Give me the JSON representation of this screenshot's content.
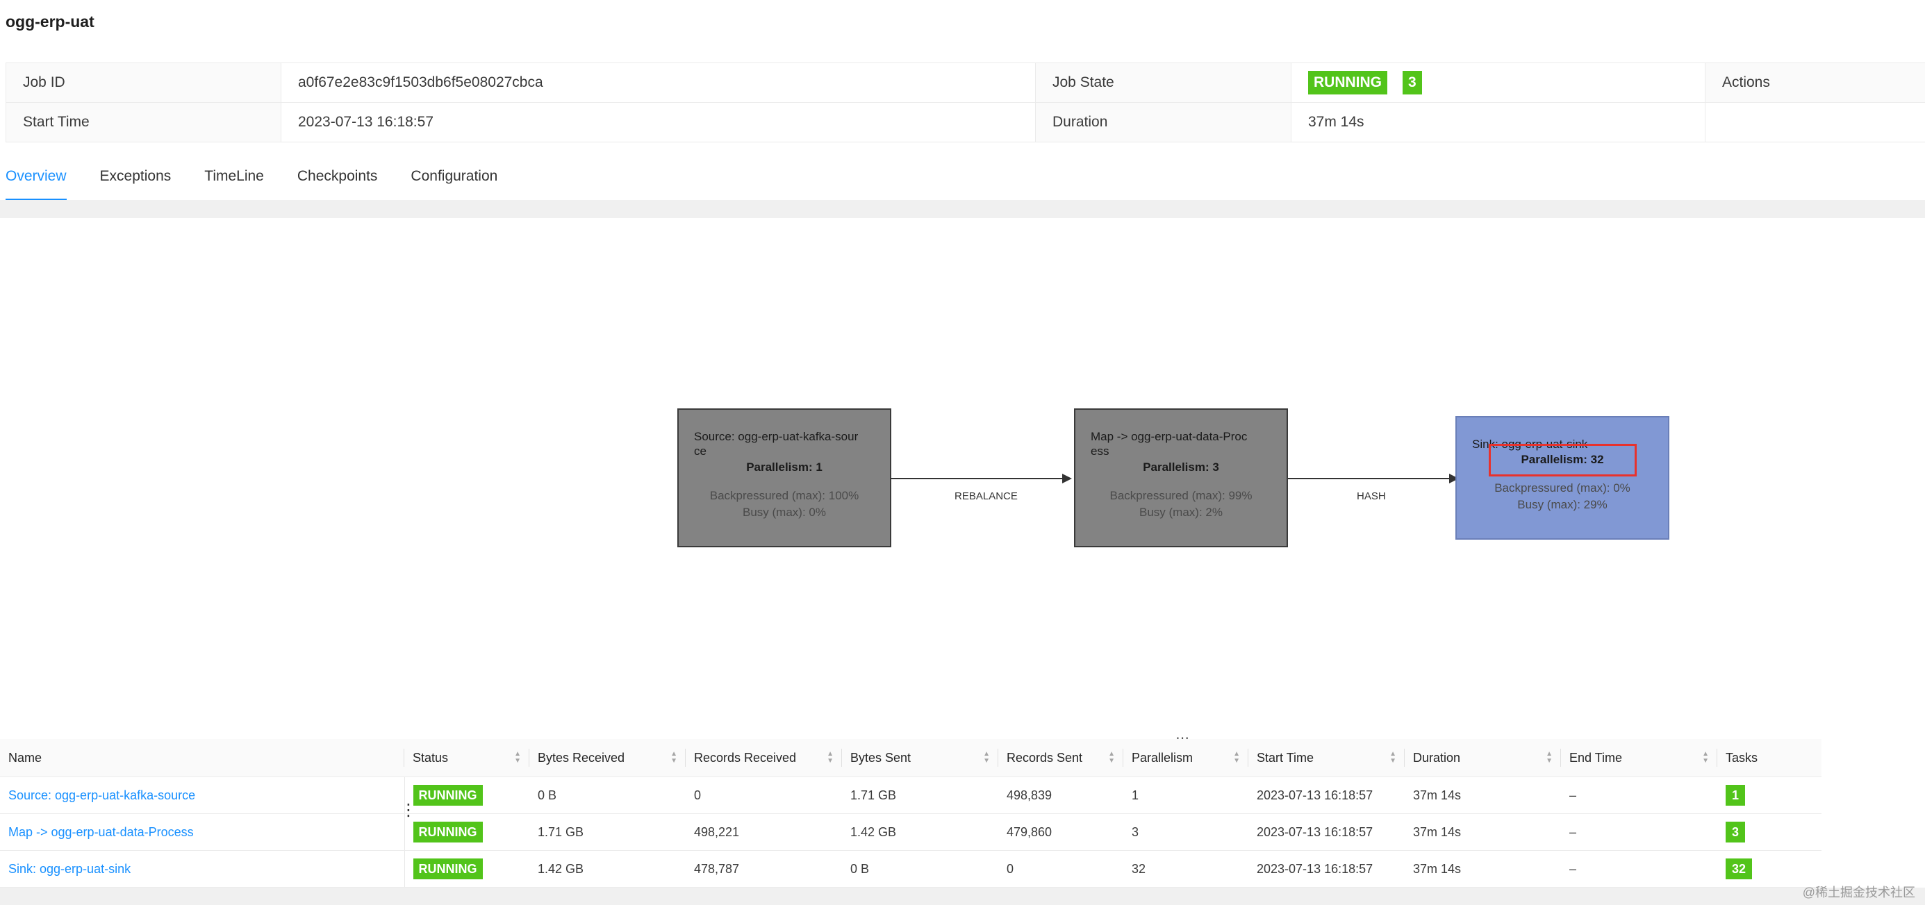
{
  "job": {
    "title": "ogg-erp-uat",
    "job_id_label": "Job ID",
    "job_id": "a0f67e2e83c9f1503db6f5e08027cbca",
    "job_state_label": "Job State",
    "job_state": "RUNNING",
    "job_state_count": "3",
    "actions_label": "Actions",
    "start_time_label": "Start Time",
    "start_time": "2023-07-13 16:18:57",
    "duration_label": "Duration",
    "duration": "37m 14s"
  },
  "tabs": [
    {
      "label": "Overview",
      "active": true
    },
    {
      "label": "Exceptions"
    },
    {
      "label": "TimeLine"
    },
    {
      "label": "Checkpoints"
    },
    {
      "label": "Configuration"
    }
  ],
  "graph": {
    "nodes": [
      {
        "name": "Source: ogg-erp-uat-kafka-source",
        "name_line1": "Source: ogg-erp-uat-kafka-sour",
        "name_line2": "ce",
        "parallelism": "Parallelism: 1",
        "backpressure": "Backpressured (max): 100%",
        "busy": "Busy (max): 0%"
      },
      {
        "name": "Map -> ogg-erp-uat-data-Process",
        "name_line1": "Map -> ogg-erp-uat-data-Proc",
        "name_line2": "ess",
        "parallelism": "Parallelism: 3",
        "backpressure": "Backpressured (max): 99%",
        "busy": "Busy (max): 2%"
      },
      {
        "name": "Sink: ogg-erp-uat-sink",
        "name_line1": "Sink: ogg-erp-uat-sink",
        "name_line2": "",
        "parallelism": "Parallelism: 32",
        "backpressure": "Backpressured (max): 0%",
        "busy": "Busy (max): 29%"
      }
    ],
    "edges": [
      {
        "label": "REBALANCE"
      },
      {
        "label": "HASH"
      }
    ],
    "highlight_color": "#e8322d"
  },
  "table": {
    "headers": [
      "Name",
      "Status",
      "Bytes Received",
      "Records Received",
      "Bytes Sent",
      "Records Sent",
      "Parallelism",
      "Start Time",
      "Duration",
      "End Time",
      "Tasks"
    ],
    "rows": [
      {
        "name": "Source: ogg-erp-uat-kafka-source",
        "status": "RUNNING",
        "bytes_received": "0 B",
        "records_received": "0",
        "bytes_sent": "1.71 GB",
        "records_sent": "498,839",
        "parallelism": "1",
        "start_time": "2023-07-13 16:18:57",
        "duration": "37m 14s",
        "end_time": "–",
        "tasks": "1"
      },
      {
        "name": "Map -> ogg-erp-uat-data-Process",
        "status": "RUNNING",
        "bytes_received": "1.71 GB",
        "records_received": "498,221",
        "bytes_sent": "1.42 GB",
        "records_sent": "479,860",
        "parallelism": "3",
        "start_time": "2023-07-13 16:18:57",
        "duration": "37m 14s",
        "end_time": "–",
        "tasks": "3"
      },
      {
        "name": "Sink: ogg-erp-uat-sink",
        "status": "RUNNING",
        "bytes_received": "1.42 GB",
        "records_received": "478,787",
        "bytes_sent": "0 B",
        "records_sent": "0",
        "parallelism": "32",
        "start_time": "2023-07-13 16:18:57",
        "duration": "37m 14s",
        "end_time": "–",
        "tasks": "32"
      }
    ]
  },
  "watermark": "@稀土掘金技术社区",
  "colors": {
    "running": "#52c41a",
    "link": "#1890ff",
    "node_gray": "#838383",
    "node_blue": "#8198d4"
  }
}
